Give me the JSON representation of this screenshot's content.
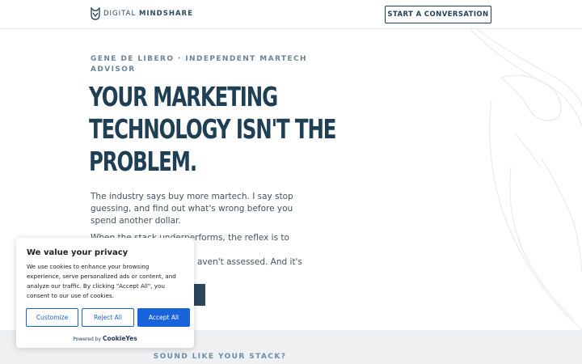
{
  "header": {
    "logo_text_light": "DIGITAL ",
    "logo_text_bold": "MINDSHARE",
    "cta_label": "START A CONVERSATION"
  },
  "hero": {
    "eyebrow": "GENE DE LIBERO · INDEPENDENT MARTECH ADVISOR",
    "headline_line1": "YOUR MARKETING",
    "headline_line2": "TECHNOLOGY ISN'T THE",
    "headline_line3": "PROBLEM.",
    "lead": "The industry says buy more martech. I say stop guessing, and find out what's wrong before you spend another dollar.",
    "body_line1": "When the stack underperforms, the reflex is to replace it.",
    "body_line2_visible": "aven't assessed. And it's"
  },
  "band": {
    "title": "SOUND LIKE YOUR STACK?"
  },
  "cookie": {
    "title": "We value your privacy",
    "text": "We use cookies to enhance your browsing experience, serve personalized ads or content, and analyze our traffic. By clicking \"Accept All\", you consent to our use of cookies.",
    "customize_label": "Customize",
    "reject_label": "Reject All",
    "accept_label": "Accept All",
    "powered_by": "Powered by",
    "powered_brand": "CookieYes"
  },
  "colors": {
    "brand_navy": "#1f3f55",
    "accent_blue": "#1863dc",
    "muted_slate": "#6b8597"
  },
  "icons": {
    "logo": "owl-logo-icon",
    "decor": "owl-outline-decoration"
  }
}
